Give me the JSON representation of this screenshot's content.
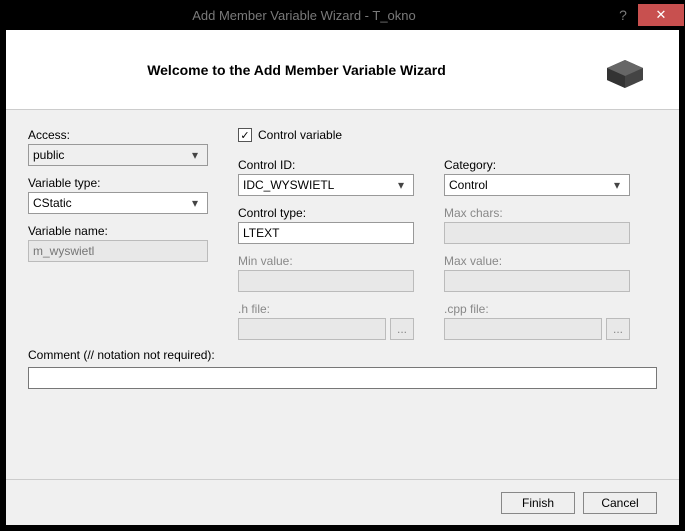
{
  "titlebar": {
    "title": "Add Member Variable Wizard - T_okno",
    "help": "?",
    "close": "✕"
  },
  "header": {
    "title": "Welcome to the Add Member Variable Wizard"
  },
  "access": {
    "label": "Access:",
    "value": "public"
  },
  "control_variable": {
    "label": "Control variable",
    "checked": "✓"
  },
  "variable_type": {
    "label": "Variable type:",
    "value": "CStatic"
  },
  "variable_name": {
    "label": "Variable name:",
    "placeholder": "m_wyswietl"
  },
  "control_id": {
    "label": "Control ID:",
    "value": "IDC_WYSWIETL"
  },
  "category": {
    "label": "Category:",
    "value": "Control"
  },
  "control_type": {
    "label": "Control type:",
    "value": "LTEXT"
  },
  "max_chars": {
    "label": "Max chars:",
    "value": ""
  },
  "min_value": {
    "label": "Min value:",
    "value": ""
  },
  "max_value": {
    "label": "Max value:",
    "value": ""
  },
  "h_file": {
    "label": ".h file:",
    "value": ""
  },
  "cpp_file": {
    "label": ".cpp file:",
    "value": ""
  },
  "comment": {
    "label": "Comment (// notation not required):",
    "value": ""
  },
  "buttons": {
    "finish": "Finish",
    "cancel": "Cancel"
  },
  "browse": "..."
}
